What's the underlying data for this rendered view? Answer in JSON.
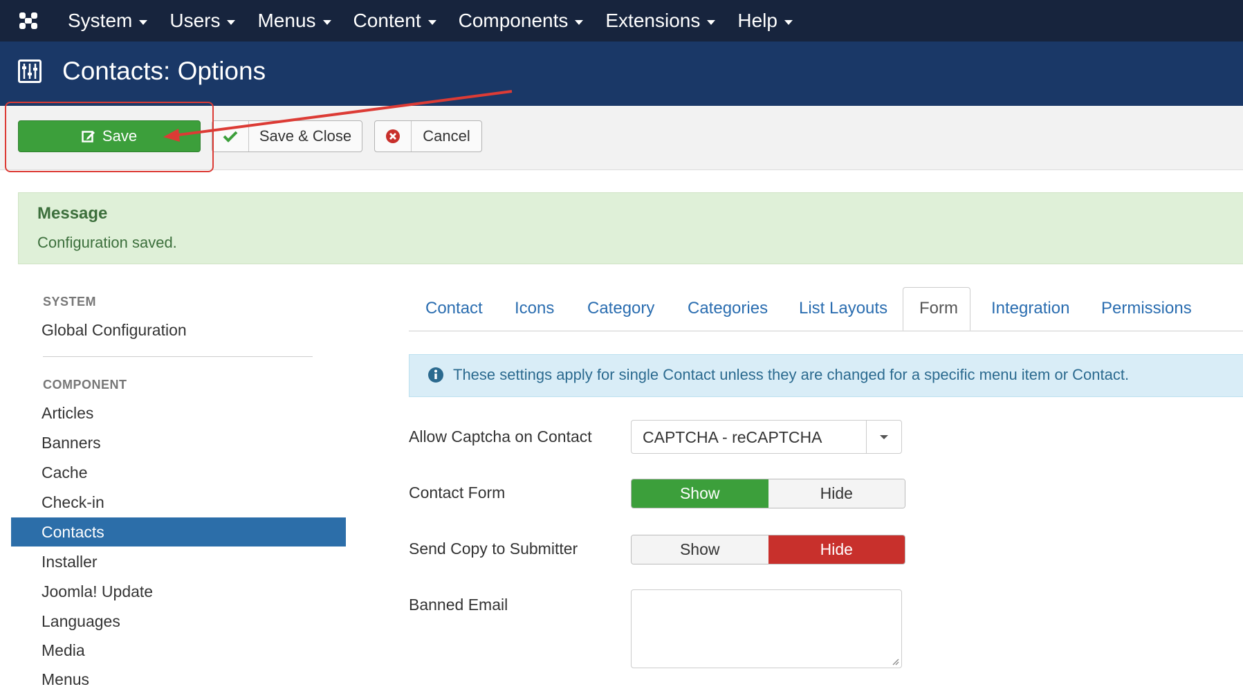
{
  "topnav": {
    "items": [
      {
        "label": "System"
      },
      {
        "label": "Users"
      },
      {
        "label": "Menus"
      },
      {
        "label": "Content"
      },
      {
        "label": "Components"
      },
      {
        "label": "Extensions"
      },
      {
        "label": "Help"
      }
    ]
  },
  "header": {
    "title": "Contacts: Options"
  },
  "toolbar": {
    "save_label": "Save",
    "save_close_label": "Save & Close",
    "cancel_label": "Cancel"
  },
  "message": {
    "heading": "Message",
    "text": "Configuration saved."
  },
  "sidebar": {
    "system_heading": "SYSTEM",
    "system_items": [
      "Global Configuration"
    ],
    "component_heading": "COMPONENT",
    "component_items": [
      "Articles",
      "Banners",
      "Cache",
      "Check-in",
      "Contacts",
      "Installer",
      "Joomla! Update",
      "Languages",
      "Media",
      "Menus"
    ],
    "active_item": "Contacts"
  },
  "tabs": [
    "Contact",
    "Icons",
    "Category",
    "Categories",
    "List Layouts",
    "Form",
    "Integration",
    "Permissions"
  ],
  "active_tab": "Form",
  "info": {
    "text": "These settings apply for single Contact unless they are changed for a specific menu item or Contact."
  },
  "form": {
    "captcha": {
      "label": "Allow Captcha on Contact",
      "value": "CAPTCHA - reCAPTCHA"
    },
    "contact_form": {
      "label": "Contact Form",
      "options": [
        "Show",
        "Hide"
      ],
      "selected": "Show"
    },
    "send_copy": {
      "label": "Send Copy to Submitter",
      "options": [
        "Show",
        "Hide"
      ],
      "selected": "Hide"
    },
    "banned_email": {
      "label": "Banned Email",
      "value": ""
    }
  },
  "colors": {
    "topbar": "#17243d",
    "header": "#1a3867",
    "save": "#3c9f3b",
    "hide_active": "#c8302c",
    "annotation": "#dc3b35",
    "link": "#2a6db0"
  },
  "icons": [
    "joomla-logo-icon",
    "options-sliders-icon",
    "edit-icon",
    "check-icon",
    "cancel-circle-icon",
    "info-icon",
    "dropdown-caret-icon",
    "resize-grip-icon"
  ]
}
